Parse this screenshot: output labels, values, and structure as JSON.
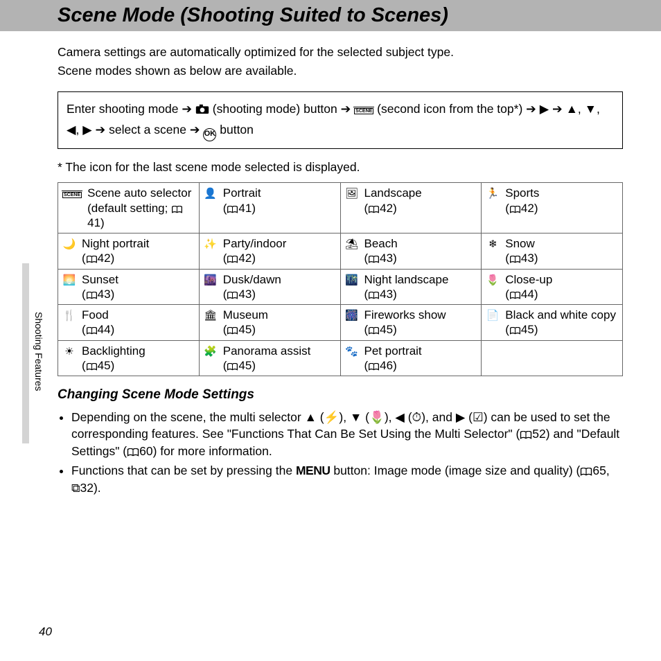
{
  "title": "Scene Mode (Shooting Suited to Scenes)",
  "intro_line1": "Camera settings are automatically optimized for the selected subject type.",
  "intro_line2": "Scene modes shown as below are available.",
  "nav": {
    "part1": "Enter shooting mode ",
    "part2": " (shooting mode) button ",
    "part3": " (second icon from the top*) ",
    "part4": " select a scene ",
    "part5": " button"
  },
  "footnote": "*  The icon for the last scene mode selected is displayed.",
  "scenes": [
    [
      {
        "icon": "SCENE",
        "name": "Scene auto selector (default setting; ",
        "page": "41)",
        "book_in_text": true
      },
      {
        "icon": "👤",
        "name": "Portrait",
        "page": "41"
      },
      {
        "icon": "🖼",
        "name": "Landscape",
        "page": "42"
      },
      {
        "icon": "🏃",
        "name": "Sports",
        "page": "42"
      }
    ],
    [
      {
        "icon": "🌙",
        "name": "Night portrait",
        "page": "42"
      },
      {
        "icon": "✨",
        "name": "Party/indoor",
        "page": "42"
      },
      {
        "icon": "⛱",
        "name": "Beach",
        "page": "43"
      },
      {
        "icon": "❄",
        "name": "Snow",
        "page": "43"
      }
    ],
    [
      {
        "icon": "🌅",
        "name": "Sunset",
        "page": "43"
      },
      {
        "icon": "🌆",
        "name": "Dusk/dawn",
        "page": "43"
      },
      {
        "icon": "🌃",
        "name": "Night landscape",
        "page": "43"
      },
      {
        "icon": "🌷",
        "name": "Close-up",
        "page": "44"
      }
    ],
    [
      {
        "icon": "🍴",
        "name": "Food",
        "page": "44"
      },
      {
        "icon": "🏛",
        "name": "Museum",
        "page": "45"
      },
      {
        "icon": "🎆",
        "name": "Fireworks show",
        "page": "45"
      },
      {
        "icon": "📄",
        "name": "Black and white copy (",
        "page": "45)",
        "book_in_text": true
      }
    ],
    [
      {
        "icon": "☀",
        "name": "Backlighting",
        "page": "45"
      },
      {
        "icon": "🧩",
        "name": "Panorama assist",
        "page": "45"
      },
      {
        "icon": "🐾",
        "name": "Pet portrait",
        "page": "46"
      },
      null
    ]
  ],
  "subheading": "Changing Scene Mode Settings",
  "bullets": {
    "b1a": "Depending on the scene, the multi selector ",
    "b1b": ", and ",
    "b1c": " can be used to set the corresponding features. See \"Functions That Can Be Set Using the Multi Selector\" (",
    "b1d": "52) and \"Default Settings\" (",
    "b1e": "60) for more information.",
    "b2a": "Functions that can be set by pressing the ",
    "b2b": " button: Image mode (image size and quality) (",
    "b2c": "65, ",
    "b2d": "32)."
  },
  "side_tab": "Shooting Features",
  "page_number": "40",
  "glyphs": {
    "arrow": "➔",
    "up": "▲",
    "down": "▼",
    "left": "◀",
    "right": "▶",
    "flash": "⚡",
    "macro": "🌷",
    "timer": "⏱",
    "exp": "☑",
    "menu": "MENU",
    "link": "⧉"
  }
}
